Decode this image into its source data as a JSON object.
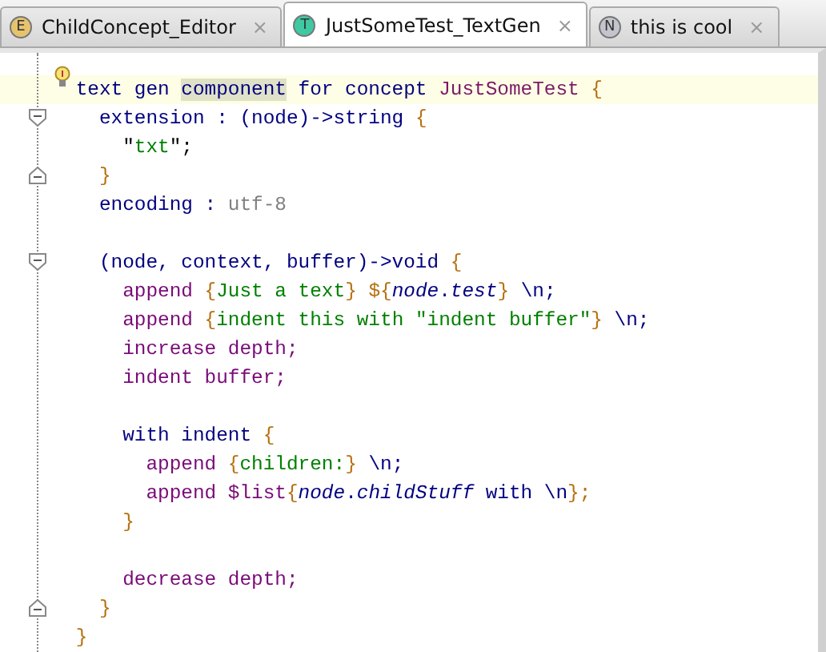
{
  "tabs": [
    {
      "badge": "E",
      "color": "#e6c36e",
      "label": "ChildConcept_Editor",
      "close": "×",
      "selected": false
    },
    {
      "badge": "T",
      "color": "#3ec9a3",
      "label": "JustSomeTest_TextGen",
      "close": "×",
      "selected": true
    },
    {
      "badge": "N",
      "color": "#c4c4cc",
      "label": "this is cool",
      "close": "×",
      "selected": false
    }
  ],
  "editor": {
    "root": {
      "current": true,
      "intention": true,
      "foldable": false,
      "tokens": [
        {
          "text": "text gen ",
          "kind": "keyword"
        },
        {
          "text": "component",
          "kind": "highlight"
        },
        {
          "text": " for concept ",
          "kind": "keyword"
        },
        {
          "text": "JustSomeTest",
          "kind": "concept"
        },
        {
          "text": " {",
          "kind": "brace"
        }
      ],
      "closing": [
        {
          "text": "}",
          "kind": "brace"
        }
      ],
      "children": [
        {
          "foldable": true,
          "tokens": [
            {
              "text": "extension : (node)->string ",
              "kind": "keyword"
            },
            {
              "text": "{",
              "kind": "brace"
            }
          ],
          "closing": [
            {
              "text": "}",
              "kind": "brace"
            }
          ],
          "children": [
            {
              "tokens": [
                {
                  "text": "\"",
                  "kind": "plain"
                },
                {
                  "text": "txt",
                  "kind": "string"
                },
                {
                  "text": "\";",
                  "kind": "plain"
                }
              ]
            }
          ]
        },
        {
          "tokens": [
            {
              "text": "encoding : ",
              "kind": "keyword"
            },
            {
              "text": "utf-8",
              "kind": "value"
            }
          ]
        },
        {
          "blank": true
        },
        {
          "foldable": true,
          "tokens": [
            {
              "text": "(node, context, buffer)->void ",
              "kind": "keyword"
            },
            {
              "text": "{",
              "kind": "brace"
            }
          ],
          "closing": [
            {
              "text": "}",
              "kind": "brace"
            }
          ],
          "children": [
            {
              "tokens": [
                {
                  "text": "append ",
                  "kind": "operation"
                },
                {
                  "text": "{",
                  "kind": "brace"
                },
                {
                  "text": "Just a text",
                  "kind": "string"
                },
                {
                  "text": "} ${",
                  "kind": "brace"
                },
                {
                  "text": "node",
                  "kind": "param"
                },
                {
                  "text": ".",
                  "kind": "keyword"
                },
                {
                  "text": "test",
                  "kind": "param"
                },
                {
                  "text": "}",
                  "kind": "brace"
                },
                {
                  "text": " \\n;",
                  "kind": "keyword"
                }
              ]
            },
            {
              "tokens": [
                {
                  "text": "append ",
                  "kind": "operation"
                },
                {
                  "text": "{",
                  "kind": "brace"
                },
                {
                  "text": "indent this with \"indent buffer\"",
                  "kind": "string"
                },
                {
                  "text": "}",
                  "kind": "brace"
                },
                {
                  "text": " \\n;",
                  "kind": "keyword"
                }
              ]
            },
            {
              "tokens": [
                {
                  "text": "increase depth;",
                  "kind": "operation"
                }
              ]
            },
            {
              "tokens": [
                {
                  "text": "indent buffer;",
                  "kind": "operation"
                }
              ]
            },
            {
              "blank": true
            },
            {
              "foldable": false,
              "tokens": [
                {
                  "text": "with indent ",
                  "kind": "keyword"
                },
                {
                  "text": "{",
                  "kind": "brace"
                }
              ],
              "closing": [
                {
                  "text": "}",
                  "kind": "brace"
                }
              ],
              "children": [
                {
                  "tokens": [
                    {
                      "text": "append ",
                      "kind": "operation"
                    },
                    {
                      "text": "{",
                      "kind": "brace"
                    },
                    {
                      "text": "children:",
                      "kind": "string"
                    },
                    {
                      "text": "}",
                      "kind": "brace"
                    },
                    {
                      "text": " \\n;",
                      "kind": "keyword"
                    }
                  ]
                },
                {
                  "tokens": [
                    {
                      "text": "append $list",
                      "kind": "operation"
                    },
                    {
                      "text": "{",
                      "kind": "brace"
                    },
                    {
                      "text": "node",
                      "kind": "param"
                    },
                    {
                      "text": ".",
                      "kind": "keyword"
                    },
                    {
                      "text": "childStuff",
                      "kind": "param"
                    },
                    {
                      "text": " with \\n",
                      "kind": "keyword"
                    },
                    {
                      "text": "};",
                      "kind": "brace"
                    }
                  ]
                }
              ]
            },
            {
              "blank": true
            },
            {
              "tokens": [
                {
                  "text": "decrease depth;",
                  "kind": "operation"
                }
              ]
            }
          ]
        }
      ]
    }
  }
}
